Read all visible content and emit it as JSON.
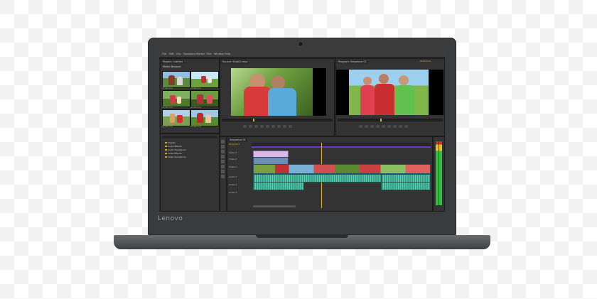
{
  "device": {
    "brand": "Lenovo"
  },
  "menu": {
    "items": [
      "File",
      "Edit",
      "Clip",
      "Sequence",
      "Marker",
      "Title",
      "Window",
      "Help"
    ]
  },
  "project_panel": {
    "tabs": [
      "Project: Untitled",
      "Media Browser"
    ],
    "files": [
      "Shot01.mov",
      "Shot02.mov",
      "Shot03.mov",
      "Shot04.mov",
      "Shot05.mov",
      "Shot06.mov"
    ]
  },
  "effects_panel": {
    "items": [
      "Presets",
      "Audio Effects",
      "Audio Transitions",
      "Video Effects",
      "Video Transitions"
    ]
  },
  "source_monitor": {
    "tab": "Source: Shot02.mov"
  },
  "program_monitor": {
    "tab": "Program: Sequence 01",
    "timecode": "00;00;24;11"
  },
  "timeline": {
    "tab": "Sequence 01",
    "timecode": "00;00;24;11",
    "tracks": [
      "Video 3",
      "Video 2",
      "Video 1",
      "Audio 1",
      "Audio 2",
      "Audio 3"
    ]
  },
  "colors": {
    "video_clip": "#6a8fb3",
    "audio_clip": "#3a9f88",
    "playhead": "#e0b020"
  }
}
